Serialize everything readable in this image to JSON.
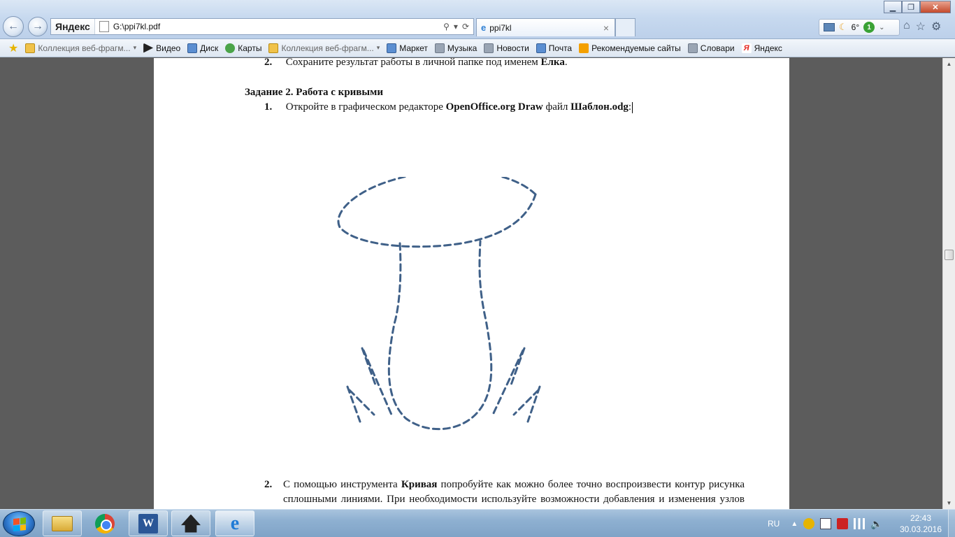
{
  "browser": {
    "address": "G:\\ppi7kl.pdf",
    "yandex_logo": "Яндекс",
    "tab_title": "ppi7kl",
    "temperature": "6°",
    "notif_count": "1",
    "caret": "▾"
  },
  "favorites": [
    {
      "label": "Коллекция веб-фрагм...",
      "icon": "web-slice-icon",
      "dropdown": true
    },
    {
      "label": "Видео",
      "icon": "video-icon",
      "dropdown": false
    },
    {
      "label": "Диск",
      "icon": "disk-icon",
      "dropdown": false
    },
    {
      "label": "Карты",
      "icon": "maps-icon",
      "dropdown": false
    },
    {
      "label": "Коллекция веб-фрагм...",
      "icon": "web-slice-icon",
      "dropdown": true
    },
    {
      "label": "Маркет",
      "icon": "market-icon",
      "dropdown": false
    },
    {
      "label": "Музыка",
      "icon": "music-icon",
      "dropdown": false
    },
    {
      "label": "Новости",
      "icon": "news-icon",
      "dropdown": false
    },
    {
      "label": "Почта",
      "icon": "mail-icon",
      "dropdown": false
    },
    {
      "label": "Рекомендуемые сайты",
      "icon": "bing-icon",
      "dropdown": false
    },
    {
      "label": "Словари",
      "icon": "dictionary-icon",
      "dropdown": false
    },
    {
      "label": "Яндекс",
      "icon": "yandex-icon",
      "dropdown": false
    }
  ],
  "document": {
    "item_top_num": "2.",
    "item_top_text": "Сохраните результат работы в личной папке под именем ",
    "item_top_bold": "Елка",
    "item_top_end": ".",
    "task_heading": "Задание 2. Работа с кривыми",
    "step1_num": "1.",
    "step1_text": "Откройте в графическом редакторе  ",
    "step1_bold1": "OpenOffice.org Draw",
    "step1_mid": " файл ",
    "step1_bold2": "Шаблон.odg",
    "step1_end": ":",
    "step2_num": "2.",
    "step2_text1": "С помощью инструмента ",
    "step2_bold": "Кривая",
    "step2_text2": " попробуйте как можно более точно воспроизвести контур рисунка сплошными линиями. При необходимости используйте возможности добавления и изменения узлов на кривых."
  },
  "taskbar": {
    "lang": "RU",
    "time": "22:43",
    "date": "30.03.2016"
  },
  "colors": {
    "dashed_outline": "#3f6088",
    "taskbar": "#8eb0d1"
  }
}
